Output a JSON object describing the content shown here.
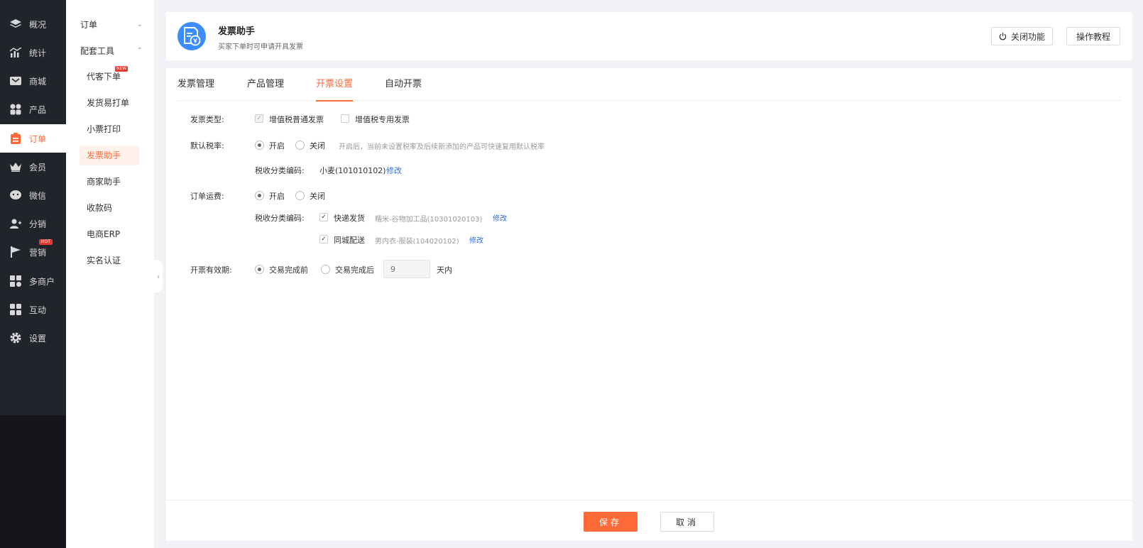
{
  "nav": {
    "items": [
      {
        "label": "概况",
        "icon": "layers-icon"
      },
      {
        "label": "统计",
        "icon": "stats-icon"
      },
      {
        "label": "商城",
        "icon": "mall-icon"
      },
      {
        "label": "产品",
        "icon": "product-icon"
      },
      {
        "label": "订单",
        "icon": "order-icon",
        "active": true
      },
      {
        "label": "会员",
        "icon": "crown-icon"
      },
      {
        "label": "微信",
        "icon": "wechat-icon"
      },
      {
        "label": "分销",
        "icon": "distribution-icon"
      },
      {
        "label": "营销",
        "icon": "flag-icon",
        "badge": "HOT"
      },
      {
        "label": "多商户",
        "icon": "multi-merchant-icon"
      },
      {
        "label": "互动",
        "icon": "interaction-icon"
      },
      {
        "label": "设置",
        "icon": "gear-icon"
      }
    ]
  },
  "subnav": {
    "group_order": "订单",
    "group_tools": "配套工具",
    "items": [
      {
        "label": "代客下单",
        "badge": "NEW"
      },
      {
        "label": "发货易打单"
      },
      {
        "label": "小票打印"
      },
      {
        "label": "发票助手",
        "active": true
      },
      {
        "label": "商家助手"
      },
      {
        "label": "收款码"
      },
      {
        "label": "电商ERP"
      },
      {
        "label": "实名认证"
      }
    ]
  },
  "header": {
    "title": "发票助手",
    "desc": "买家下单时可申请开具发票",
    "close_feature": "关闭功能",
    "tutorial": "操作教程"
  },
  "tabs": [
    "发票管理",
    "产品管理",
    "开票设置",
    "自动开票"
  ],
  "active_tab": "开票设置",
  "form": {
    "invoice_type": {
      "label": "发票类型:",
      "opt1": "增值税普通发票",
      "opt2": "增值税专用发票"
    },
    "default_tax": {
      "label": "默认税率:",
      "on": "开启",
      "off": "关闭",
      "hint": "开启后，当前未设置税率及后续新添加的产品可快速复用默认税率",
      "code_label": "税收分类编码:",
      "code_value": "小麦(101010102)",
      "edit": "修改"
    },
    "shipping": {
      "label": "订单运费:",
      "on": "开启",
      "off": "关闭",
      "code_label": "税收分类编码:",
      "express_label": "快递发货",
      "express_value": "糯米-谷物加工品(10301020103)",
      "local_label": "同城配送",
      "local_value": "男内衣-服装(104020102)",
      "edit": "修改"
    },
    "validity": {
      "label": "开票有效期:",
      "before": "交易完成前",
      "after": "交易完成后",
      "days_placeholder": "9",
      "days_unit": "天内"
    }
  },
  "footer": {
    "save": "保存",
    "cancel": "取消"
  },
  "colors": {
    "accent": "#ff6a39",
    "nav_bg": "#22242b",
    "link": "#2d6cdf"
  }
}
